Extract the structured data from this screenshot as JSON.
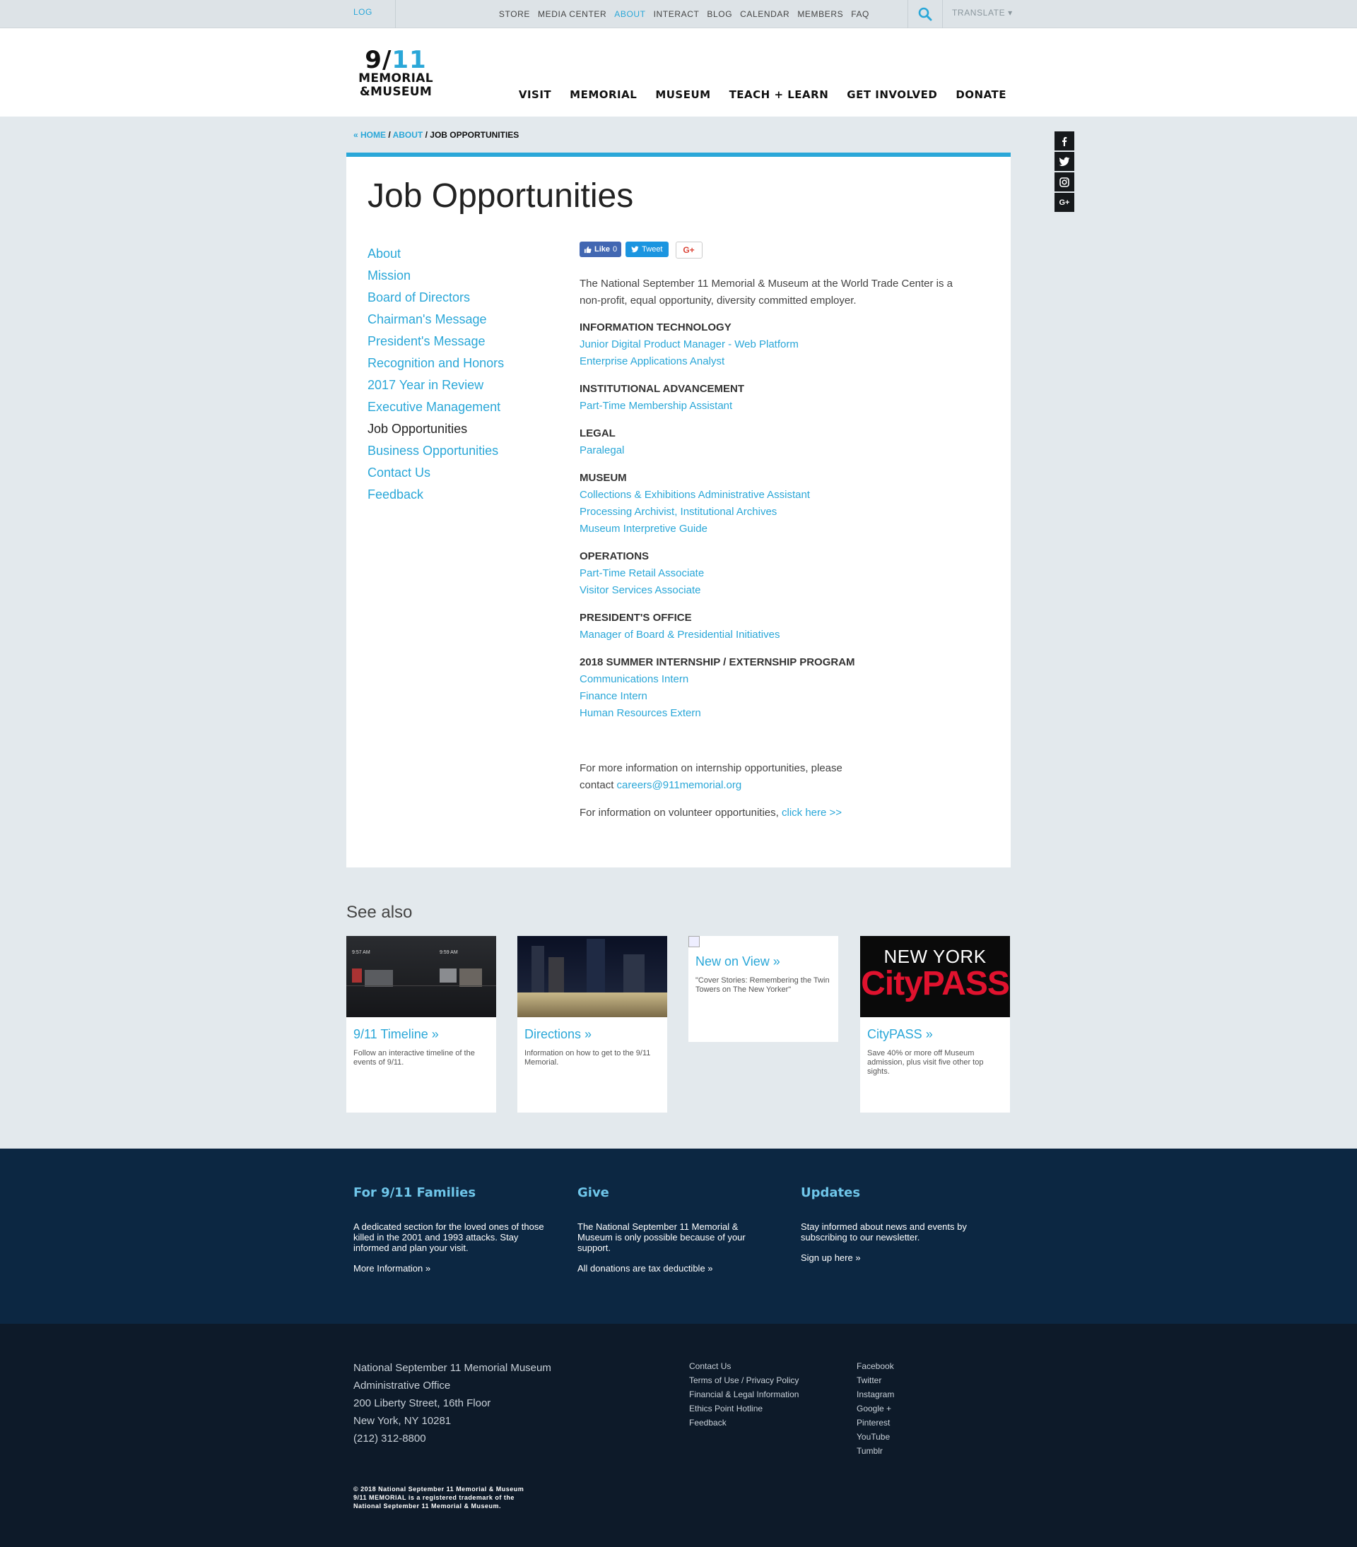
{
  "utility": {
    "login": "LOG IN",
    "links": [
      "STORE",
      "MEDIA CENTER",
      "ABOUT",
      "INTERACT",
      "BLOG",
      "CALENDAR",
      "MEMBERS",
      "FAQ"
    ],
    "active": "ABOUT",
    "translate": "TRANSLATE ▾"
  },
  "logo": {
    "number_a": "9/",
    "number_b": "11",
    "line1": "MEMORIAL",
    "line2": "&MUSEUM"
  },
  "mainnav": [
    "VISIT",
    "MEMORIAL",
    "MUSEUM",
    "TEACH + LEARN",
    "GET INVOLVED",
    "DONATE"
  ],
  "breadcrumb": {
    "home": "« HOME",
    "sep1": " / ",
    "about": "ABOUT",
    "sep2": " / ",
    "current": "JOB OPPORTUNITIES"
  },
  "social_side": [
    "f",
    "t",
    "ig",
    "G+"
  ],
  "page": {
    "title": "Job Opportunities"
  },
  "sidenav": [
    "About",
    "Mission",
    "Board of Directors",
    "Chairman's Message",
    "President's Message",
    "Recognition and Honors",
    "2017 Year in Review",
    "Executive Management",
    "Job Opportunities",
    "Business Opportunities",
    "Contact Us",
    "Feedback"
  ],
  "sidenav_current": "Job Opportunities",
  "share": {
    "like": "Like",
    "like_count": "0",
    "tweet": "Tweet",
    "gplus": "G+"
  },
  "intro": "The National September 11 Memorial & Museum at the World Trade Center is a non-profit, equal opportunity, diversity committed employer.",
  "sections": [
    {
      "heading": "INFORMATION TECHNOLOGY",
      "jobs": [
        "Junior Digital Product Manager - Web Platform",
        "Enterprise Applications Analyst"
      ]
    },
    {
      "heading": "INSTITUTIONAL ADVANCEMENT",
      "jobs": [
        "Part-Time Membership Assistant"
      ]
    },
    {
      "heading": "LEGAL",
      "jobs": [
        "Paralegal"
      ]
    },
    {
      "heading": "MUSEUM",
      "jobs": [
        "Collections & Exhibitions Administrative Assistant",
        "Processing Archivist, Institutional Archives",
        "Museum Interpretive Guide"
      ]
    },
    {
      "heading": "OPERATIONS",
      "jobs": [
        "Part-Time Retail Associate",
        "Visitor Services Associate"
      ]
    },
    {
      "heading": "PRESIDENT'S OFFICE",
      "jobs": [
        "Manager of Board & Presidential Initiatives"
      ]
    },
    {
      "heading": "2018 SUMMER INTERNSHIP / EXTERNSHIP PROGRAM",
      "jobs": [
        "Communications Intern",
        "Finance Intern",
        "Human Resources Extern"
      ]
    }
  ],
  "more_info": {
    "text1": "For more information on internship opportunities, please contact ",
    "email": "careers@911memorial.org",
    "text2": "For information on volunteer opportunities, ",
    "volunteer_link": "click here >>"
  },
  "seealso": {
    "title": "See also",
    "tiles": [
      {
        "title": "9/11 Timeline »",
        "desc": "Follow an interactive timeline of the events of 9/11.",
        "img_text_a": "9:57 AM",
        "img_text_b": "9:59 AM"
      },
      {
        "title": "Directions »",
        "desc": "Information on how to get to the 9/11 Memorial."
      },
      {
        "title": "New on View »",
        "desc": "\"Cover Stories: Remembering the Twin Towers on The New Yorker\""
      },
      {
        "title": "CityPASS »",
        "desc": "Save 40% or more off Museum admission, plus visit five other top sights.",
        "img_line1": "NEW YORK",
        "img_line2": "CityPASS"
      }
    ]
  },
  "footer_cols": [
    {
      "heading": "For 9/11 Families",
      "text": "A dedicated section for the loved ones of those killed in the 2001 and 1993 attacks. Stay informed and plan your visit.",
      "link": "More Information »"
    },
    {
      "heading": "Give",
      "text": "The National September 11 Memorial & Museum is only possible because of your support.",
      "link": "All donations are tax deductible »"
    },
    {
      "heading": "Updates",
      "text": "Stay informed about news and events by subscribing to our newsletter.",
      "link": "Sign up here »"
    }
  ],
  "address": [
    "National September 11 Memorial Museum",
    "Administrative Office",
    "200 Liberty Street, 16th Floor",
    "New York, NY 10281",
    "(212) 312-8800"
  ],
  "footer_links1": [
    "Contact Us",
    "Terms of Use / Privacy Policy",
    "Financial & Legal Information",
    "Ethics Point Hotline",
    "Feedback"
  ],
  "footer_links2": [
    "Facebook",
    "Twitter",
    "Instagram",
    "Google +",
    "Pinterest",
    "YouTube",
    "Tumblr"
  ],
  "copyright": [
    "© 2018 National September 11 Memorial & Museum",
    "9/11 MEMORIAL is a registered trademark of the",
    "National September 11 Memorial & Museum."
  ],
  "colors": {
    "accent": "#2aa7d8",
    "footer_blue": "#0c2742",
    "footer_dark": "#0d1a29",
    "background": "#e3e9ed"
  }
}
